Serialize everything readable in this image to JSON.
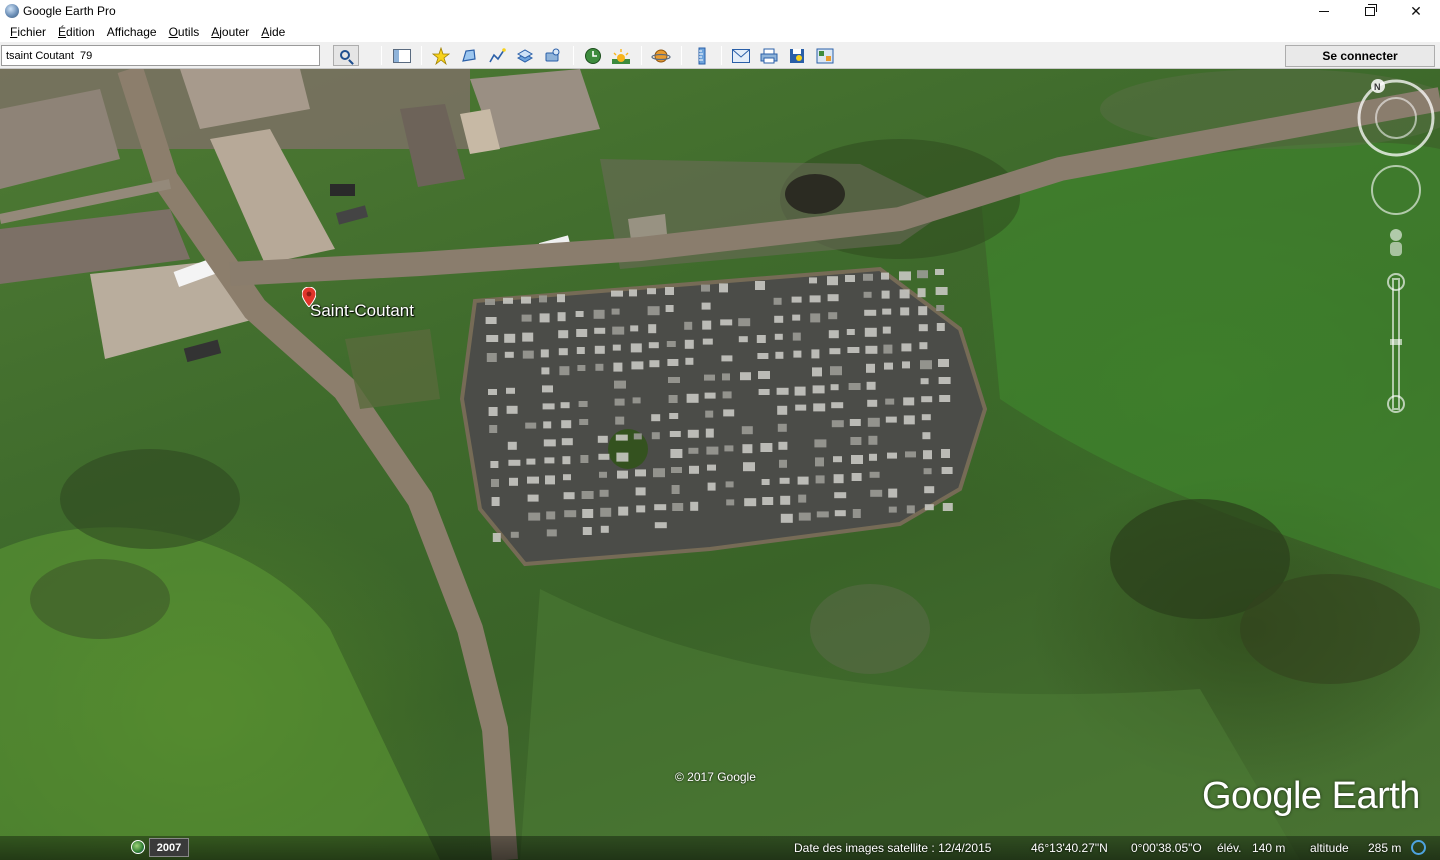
{
  "window": {
    "title": "Google Earth Pro",
    "controls": {
      "minimize_icon": "minimize-icon",
      "maximize_icon": "restore-icon",
      "close_icon": "close-icon"
    }
  },
  "menu": {
    "items": [
      {
        "label": "Fichier",
        "accel": "F"
      },
      {
        "label": "Édition",
        "accel": "É"
      },
      {
        "label": "Affichage",
        "accel": ""
      },
      {
        "label": "Outils",
        "accel": "O"
      },
      {
        "label": "Ajouter",
        "accel": "A"
      },
      {
        "label": "Aide",
        "accel": "A"
      }
    ]
  },
  "toolbar": {
    "search_value": "tsaint Coutant  79",
    "search_icon": "search-icon",
    "buttons": [
      {
        "name": "sidebar-toggle-button",
        "icon": "sidebar-icon"
      },
      {
        "name": "add-placemark-button",
        "icon": "placemark-pin-icon"
      },
      {
        "name": "add-polygon-button",
        "icon": "polygon-icon"
      },
      {
        "name": "add-path-button",
        "icon": "path-icon"
      },
      {
        "name": "image-overlay-button",
        "icon": "image-overlay-icon"
      },
      {
        "name": "record-tour-button",
        "icon": "record-tour-icon"
      },
      {
        "name": "historical-imagery-button",
        "icon": "clock-icon"
      },
      {
        "name": "sunlight-button",
        "icon": "sun-icon"
      },
      {
        "name": "switch-planet-button",
        "icon": "planet-icon"
      },
      {
        "name": "ruler-button",
        "icon": "ruler-icon"
      },
      {
        "name": "email-button",
        "icon": "email-icon"
      },
      {
        "name": "print-button",
        "icon": "print-icon"
      },
      {
        "name": "save-image-button",
        "icon": "save-image-icon"
      },
      {
        "name": "view-in-maps-button",
        "icon": "maps-icon"
      }
    ],
    "connect_label": "Se connecter"
  },
  "map": {
    "placemark_label": "Saint-Coutant",
    "copyright": "© 2017 Google",
    "logo_text": "Google Earth",
    "compass_letter": "N"
  },
  "status": {
    "year": "2007",
    "imagery_date": "Date des images satellite : 12/4/2015",
    "latitude": "46°13'40.27\"N",
    "longitude": "0°00'38.05\"O",
    "elevation_label": "élév.",
    "elevation_value": "140 m",
    "altitude_label": "altitude",
    "altitude_value": "285 m"
  },
  "colors": {
    "grass": "#4a7433",
    "road": "#8a7a68",
    "placemark_red": "#e2352b",
    "loading_blue": "#4ea3e0"
  }
}
